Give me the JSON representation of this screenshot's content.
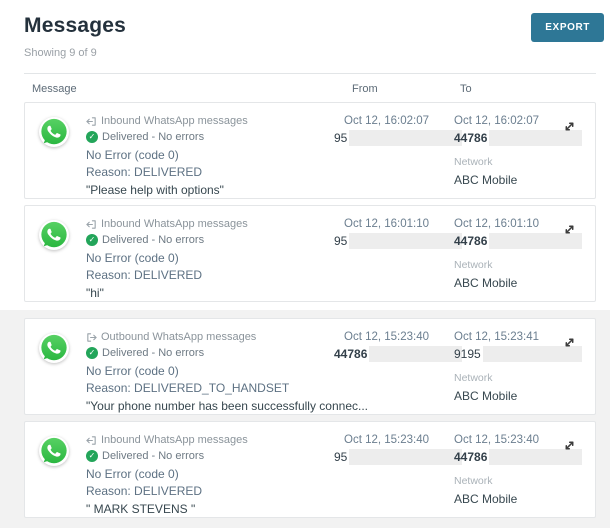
{
  "page": {
    "title": "Messages",
    "subtitle": "Showing 9 of 9",
    "export_button": "EXPORT"
  },
  "table": {
    "columns": {
      "message": "Message",
      "from": "From",
      "to": "To"
    }
  },
  "network_label": "Network",
  "rows": [
    {
      "direction": "inbound",
      "type_label": "Inbound WhatsApp messages",
      "status": "Delivered - No errors",
      "error": "No Error (code 0)",
      "reason": "Reason: DELIVERED",
      "message": "\"Please help with options\"",
      "from_time": "Oct 12, 16:02:07",
      "from_number": "95",
      "to_time": "Oct 12, 16:02:07",
      "to_number": "44786",
      "network": "ABC Mobile"
    },
    {
      "direction": "inbound",
      "type_label": "Inbound WhatsApp messages",
      "status": "Delivered - No errors",
      "error": "No Error (code 0)",
      "reason": "Reason: DELIVERED",
      "message": "\"hi\"",
      "from_time": "Oct 12, 16:01:10",
      "from_number": "95",
      "to_time": "Oct 12, 16:01:10",
      "to_number": "44786",
      "network": "ABC Mobile"
    },
    {
      "direction": "outbound",
      "type_label": "Outbound WhatsApp messages",
      "status": "Delivered - No errors",
      "error": "No Error (code 0)",
      "reason": "Reason: DELIVERED_TO_HANDSET",
      "message": "\"Your phone number has been successfully connec...",
      "from_time": "Oct 12, 15:23:40",
      "from_number": "44786",
      "to_time": "Oct 12, 15:23:41",
      "to_number": "9195",
      "network": "ABC Mobile"
    },
    {
      "direction": "inbound",
      "type_label": "Inbound WhatsApp messages",
      "status": "Delivered - No errors",
      "error": "No Error (code 0)",
      "reason": "Reason: DELIVERED",
      "message": "\" MARK STEVENS \"",
      "from_time": "Oct 12, 15:23:40",
      "from_number": "95",
      "to_time": "Oct 12, 15:23:40",
      "to_number": "44786",
      "network": "ABC Mobile"
    }
  ],
  "icons": {
    "whatsapp": "whatsapp-icon",
    "inbound": "inbound-message-icon",
    "outbound": "outbound-message-icon",
    "delivered_check": "check-circle-icon",
    "expand": "expand-icon"
  },
  "colors": {
    "export_button": "#2e7796",
    "whatsapp_green_light": "#57d163",
    "whatsapp_green_dark": "#2bb741",
    "check_green": "#23a55a",
    "redaction_gray": "#ededed",
    "card_border": "#e4e6e8",
    "lower_band_bg": "#f2f2f2",
    "slate_text": "#5d7183"
  }
}
